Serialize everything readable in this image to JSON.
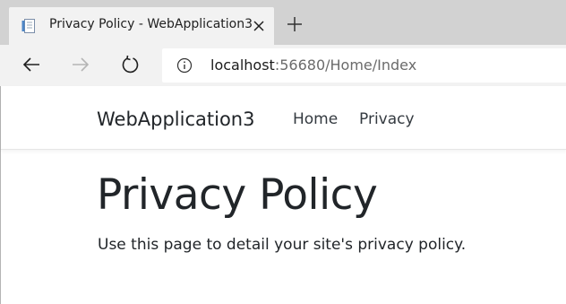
{
  "browser": {
    "tab": {
      "title": "Privacy Policy - WebApplication3",
      "favicon": "page-icon"
    },
    "new_tab_icon": "plus-icon",
    "toolbar": {
      "back_icon": "arrow-left-icon",
      "forward_icon": "arrow-right-icon",
      "refresh_icon": "refresh-icon",
      "info_icon": "info-circle-icon"
    },
    "address": {
      "host": "localhost",
      "rest": ":56680/Home/Index"
    }
  },
  "site": {
    "brand": "WebApplication3",
    "nav": [
      {
        "label": "Home"
      },
      {
        "label": "Privacy"
      }
    ],
    "heading": "Privacy Policy",
    "description": "Use this page to detail your site's privacy policy."
  },
  "colors": {
    "tabstrip_bg": "#d2d2d2",
    "toolbar_bg": "#f2f2f2",
    "text": "#212529"
  }
}
